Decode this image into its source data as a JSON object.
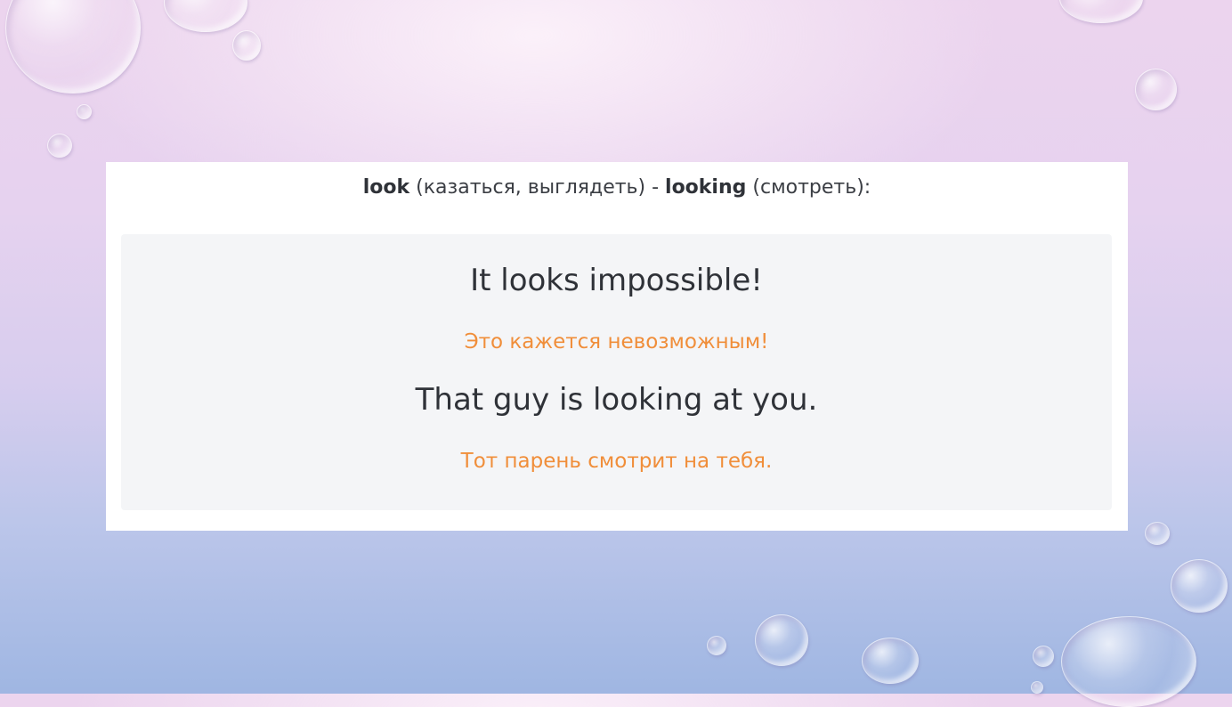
{
  "heading": {
    "word1": "look",
    "word1_translation": " (казаться, выглядеть) - ",
    "word2": "looking",
    "word2_translation": " (смотреть):"
  },
  "examples": [
    {
      "english": "It looks impossible!",
      "russian": "Это кажется невозможным!"
    },
    {
      "english": "That guy is looking at you.",
      "russian": "Тот парень смотрит на тебя."
    }
  ],
  "colors": {
    "translation": "#f08e3a",
    "text": "#2f3238",
    "panel": "#f4f5f7"
  }
}
